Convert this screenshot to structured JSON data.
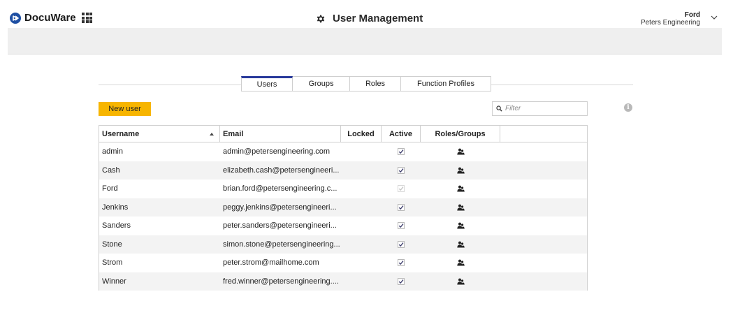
{
  "header": {
    "logo_text": "DocuWare",
    "title": "User Management",
    "user_name": "Ford",
    "user_org": "Peters Engineering"
  },
  "tabs": [
    {
      "label": "Users",
      "active": true
    },
    {
      "label": "Groups",
      "active": false
    },
    {
      "label": "Roles",
      "active": false
    },
    {
      "label": "Function Profiles",
      "active": false
    }
  ],
  "toolbar": {
    "new_user_label": "New user",
    "filter_placeholder": "Filter"
  },
  "table": {
    "columns": [
      "Username",
      "Email",
      "Locked",
      "Active",
      "Roles/Groups"
    ],
    "sorted_by": "Username",
    "sort_direction": "ascending",
    "rows": [
      {
        "username": "admin",
        "email": "admin@petersengineering.com",
        "locked": false,
        "active": true,
        "active_disabled": false
      },
      {
        "username": "Cash",
        "email": "elizabeth.cash@petersengineeri...",
        "locked": false,
        "active": true,
        "active_disabled": false
      },
      {
        "username": "Ford",
        "email": "brian.ford@petersengineering.c...",
        "locked": false,
        "active": true,
        "active_disabled": true
      },
      {
        "username": "Jenkins",
        "email": "peggy.jenkins@petersengineeri...",
        "locked": false,
        "active": true,
        "active_disabled": false
      },
      {
        "username": "Sanders",
        "email": "peter.sanders@petersengineeri...",
        "locked": false,
        "active": true,
        "active_disabled": false
      },
      {
        "username": "Stone",
        "email": "simon.stone@petersengineering...",
        "locked": false,
        "active": true,
        "active_disabled": false
      },
      {
        "username": "Strom",
        "email": "peter.strom@mailhome.com",
        "locked": false,
        "active": true,
        "active_disabled": false
      },
      {
        "username": "Winner",
        "email": "fred.winner@petersengineering....",
        "locked": false,
        "active": true,
        "active_disabled": false
      }
    ]
  },
  "icons": {
    "logo": "docuware-logo-icon",
    "apps": "app-grid-icon",
    "title": "gear-icon",
    "user_menu": "chevron-down-icon",
    "filter": "search-icon",
    "info": "info-icon",
    "roles": "people-icon",
    "sort": "sort-ascending-icon"
  },
  "colors": {
    "accent": "#27389a",
    "button": "#f7b500",
    "logo": "#1e4fa3",
    "band": "#efefef",
    "row_alt": "#f3f3f3"
  }
}
